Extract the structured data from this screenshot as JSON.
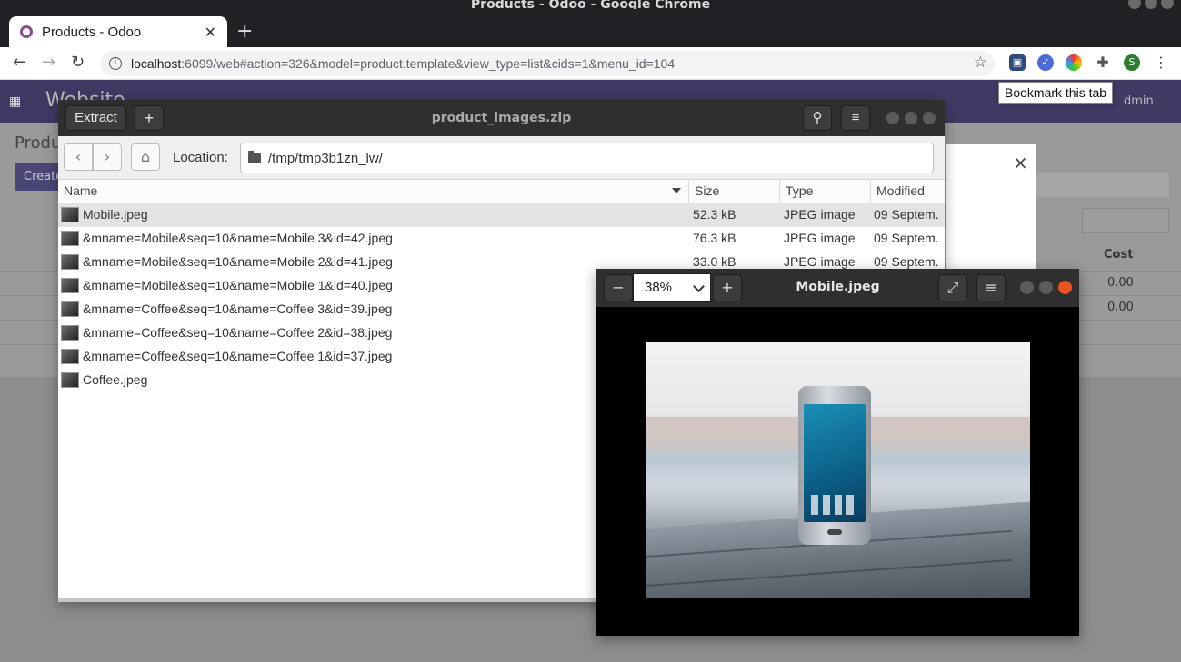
{
  "chrome": {
    "window_title": "Products - Odoo - Google Chrome",
    "tab_title": "Products - Odoo",
    "url_host": "localhost",
    "url_path": ":6099/web#action=326&model=product.template&view_type=list&cids=1&menu_id=104",
    "tooltip": "Bookmark this tab",
    "profile_initial": "S"
  },
  "odoo": {
    "brand": "Website",
    "page_title": "Produ",
    "create_label": "Create",
    "admin_label": "dmin",
    "cost_header": "Cost",
    "cost_values": [
      "0.00",
      "0.00"
    ]
  },
  "archive": {
    "extract_label": "Extract",
    "add_label": "+",
    "title": "product_images.zip",
    "location_label": "Location:",
    "location_path": "/tmp/tmp3b1zn_lw/",
    "columns": {
      "name": "Name",
      "size": "Size",
      "type": "Type",
      "modified": "Modified"
    },
    "files": [
      {
        "name": "Mobile.jpeg",
        "size": "52.3 kB",
        "type": "JPEG image",
        "modified": "09 Septem."
      },
      {
        "name": "&mname=Mobile&seq=10&name=Mobile 3&id=42.jpeg",
        "size": "76.3 kB",
        "type": "JPEG image",
        "modified": "09 Septem."
      },
      {
        "name": "&mname=Mobile&seq=10&name=Mobile 2&id=41.jpeg",
        "size": "33.0 kB",
        "type": "JPEG image",
        "modified": "09 Septem."
      },
      {
        "name": "&mname=Mobile&seq=10&name=Mobile 1&id=40.jpeg",
        "size": "",
        "type": "",
        "modified": ""
      },
      {
        "name": "&mname=Coffee&seq=10&name=Coffee 3&id=39.jpeg",
        "size": "",
        "type": "",
        "modified": ""
      },
      {
        "name": "&mname=Coffee&seq=10&name=Coffee 2&id=38.jpeg",
        "size": "",
        "type": "",
        "modified": ""
      },
      {
        "name": "&mname=Coffee&seq=10&name=Coffee 1&id=37.jpeg",
        "size": "",
        "type": "",
        "modified": ""
      },
      {
        "name": "Coffee.jpeg",
        "size": "",
        "type": "",
        "modified": ""
      }
    ]
  },
  "viewer": {
    "title": "Mobile.jpeg",
    "zoom": "38%"
  },
  "colors": {
    "odoo_nav": "#3f3963",
    "viewer_close": "#e95420",
    "header_dark": "#2f2f2f"
  }
}
